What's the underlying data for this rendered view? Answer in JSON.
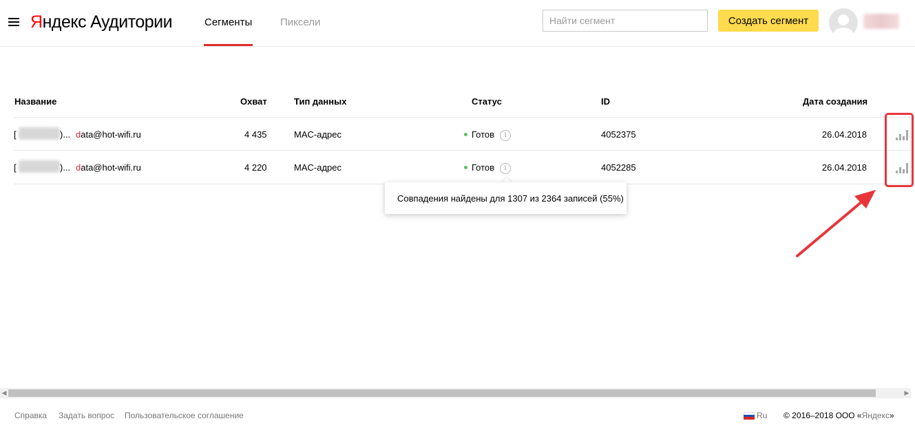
{
  "header": {
    "logo_first_letter": "Я",
    "logo_rest": "ндекс",
    "product": "Аудитории",
    "tabs": [
      {
        "label": "Сегменты",
        "active": true
      },
      {
        "label": "Пиксели",
        "active": false
      }
    ],
    "search_placeholder": "Найти сегмент",
    "create_button": "Создать сегмент"
  },
  "table": {
    "columns": [
      "Название",
      "Охват",
      "Тип данных",
      "Статус",
      "ID",
      "Дата создания"
    ],
    "rows": [
      {
        "name_prefix": "[",
        "name_suffix": ")...",
        "email_first": "d",
        "email_rest": "ata@hot-wifi.ru",
        "reach": "4 435",
        "data_type": "MAC-адрес",
        "status": "Готов",
        "id": "4052375",
        "date": "26.04.2018"
      },
      {
        "name_prefix": "[",
        "name_suffix": ")...",
        "email_first": "d",
        "email_rest": "ata@hot-wifi.ru",
        "reach": "4 220",
        "data_type": "MAC-адрес",
        "status": "Готов",
        "id": "4052285",
        "date": "26.04.2018"
      }
    ]
  },
  "tooltip": {
    "text": "Совпадения найдены для 1307 из 2364 записей (55%)"
  },
  "icons": {
    "info": "i",
    "scroll_left": "◀",
    "scroll_right": "▶"
  },
  "colors": {
    "accent_red": "#e02828",
    "button_yellow": "#ffdb4d",
    "status_green": "#5bc25b",
    "annotation_red": "#e8353a"
  },
  "footer": {
    "links": [
      "Справка",
      "Задать вопрос",
      "Пользовательское соглашение"
    ],
    "lang": "Ru",
    "copyright_prefix": "© 2016–2018 ООО «",
    "copyright_brand": "Яндекс",
    "copyright_suffix": "»"
  }
}
